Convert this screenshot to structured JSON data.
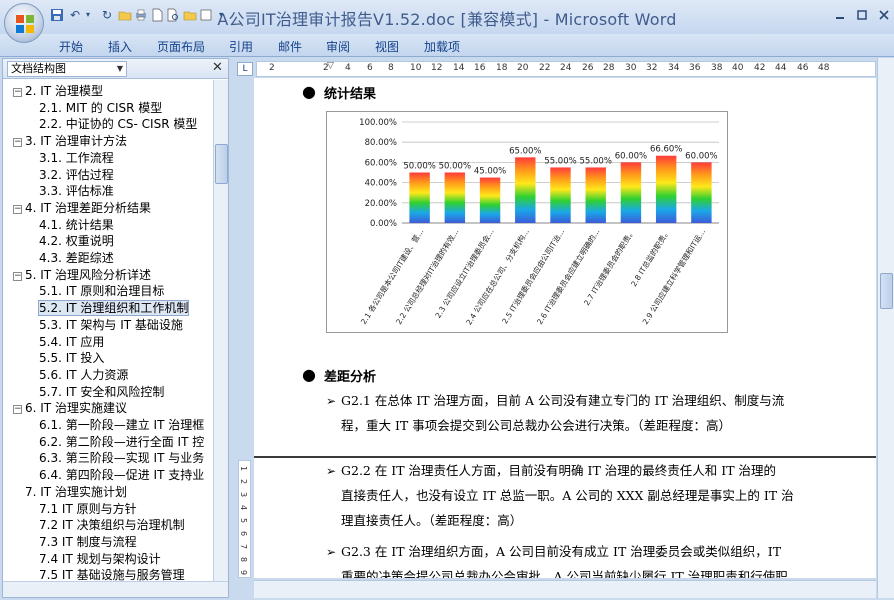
{
  "window": {
    "title": "A公司IT治理审计报告V1.52.doc [兼容模式] - Microsoft Word"
  },
  "ribbon": {
    "tabs": [
      "开始",
      "插入",
      "页面布局",
      "引用",
      "邮件",
      "审阅",
      "视图",
      "加载项"
    ]
  },
  "docmap": {
    "header": "文档结构图",
    "items": [
      {
        "label": "2. IT 治理模型",
        "level": 1,
        "toggle": "−"
      },
      {
        "label": "2.1. MIT 的 CISR 模型",
        "level": 2
      },
      {
        "label": "2.2. 中证协的 CS- CISR 模型",
        "level": 2
      },
      {
        "label": "3. IT 治理审计方法",
        "level": 1,
        "toggle": "−"
      },
      {
        "label": "3.1. 工作流程",
        "level": 2
      },
      {
        "label": "3.2. 评估过程",
        "level": 2
      },
      {
        "label": "3.3. 评估标准",
        "level": 2
      },
      {
        "label": "4. IT 治理差距分析结果",
        "level": 1,
        "toggle": "−"
      },
      {
        "label": "4.1. 统计结果",
        "level": 2
      },
      {
        "label": "4.2. 权重说明",
        "level": 2
      },
      {
        "label": "4.3. 差距综述",
        "level": 2
      },
      {
        "label": "5. IT 治理风险分析详述",
        "level": 1,
        "toggle": "−"
      },
      {
        "label": "5.1. IT 原则和治理目标",
        "level": 2
      },
      {
        "label": "5.2. IT 治理组织和工作机制",
        "level": 2,
        "selected": true
      },
      {
        "label": "5.3. IT 架构与 IT 基础设施",
        "level": 2
      },
      {
        "label": "5.4. IT 应用",
        "level": 2
      },
      {
        "label": "5.5. IT 投入",
        "level": 2
      },
      {
        "label": "5.6. IT 人力资源",
        "level": 2
      },
      {
        "label": "5.7. IT 安全和风险控制",
        "level": 2
      },
      {
        "label": "6. IT 治理实施建议",
        "level": 1,
        "toggle": "−"
      },
      {
        "label": "6.1. 第一阶段—建立 IT 治理框",
        "level": 2
      },
      {
        "label": "6.2. 第二阶段—进行全面 IT 控",
        "level": 2
      },
      {
        "label": "6.3. 第三阶段—实现 IT 与业务",
        "level": 2
      },
      {
        "label": "6.4. 第四阶段—促进 IT 支持业",
        "level": 2
      },
      {
        "label": "7. IT 治理实施计划",
        "level": 1
      },
      {
        "label": "7.1 IT 原则与方针",
        "level": 2
      },
      {
        "label": "7.2 IT 决策组织与治理机制",
        "level": 2
      },
      {
        "label": "7.3 IT 制度与流程",
        "level": 2
      },
      {
        "label": "7.4 IT 规划与架构设计",
        "level": 2
      },
      {
        "label": "7.5 IT 基础设施与服务管理",
        "level": 2
      }
    ]
  },
  "ruler": {
    "ticks": [
      "2",
      "2",
      "4",
      "6",
      "8",
      "10",
      "12",
      "14",
      "16",
      "18",
      "20",
      "22",
      "24",
      "26",
      "28",
      "30",
      "32",
      "34",
      "36",
      "38",
      "40",
      "42",
      "44",
      "46",
      "48"
    ],
    "vticks": [
      "1",
      "2",
      "3",
      "4",
      "5",
      "6",
      "7",
      "8",
      "9"
    ]
  },
  "doc": {
    "heading1": "统计结果",
    "heading2": "差距分析",
    "paragraphs": [
      {
        "lines": [
          "G2.1  在总体 IT 治理方面，目前 A 公司没有建立专门的 IT 治理组织、制度与流",
          "程，重大 IT 事项会提交到公司总裁办公会进行决策。（差距程度：高）"
        ]
      },
      {
        "lines": [
          "G2.2  在 IT 治理责任人方面，目前没有明确 IT 治理的最终责任人和 IT 治理的",
          "直接责任人，也没有设立 IT 总监一职。A 公司的 XXX 副总经理是事实上的 IT 治",
          "理直接责任人。（差距程度：高）"
        ]
      },
      {
        "lines": [
          "G2.3  在 IT 治理组织方面，A 公司目前没有成立 IT 治理委员会或类似组织，IT",
          "重要的决策会提公司总裁办公会审批。A 公司当前缺少履行 IT 治理职责和行使职"
        ]
      }
    ]
  },
  "chart_data": {
    "type": "bar",
    "categories": [
      "2.1 各公司是本公司IT建设、营...",
      "2.2 公司总经理对IT治理的有效...",
      "2.3 公司应设立IT治理委员会...",
      "2.4 公司应在总公司、分支机构...",
      "2.5 IT治理委员会应由公司IT治...",
      "2.6 IT治理委员会应建立明确的...",
      "2.7 IT治理委员会的职责。",
      "2.8 IT总监的职责。",
      "2.9 公司应建立科学管理和IT运..."
    ],
    "values": [
      50.0,
      50.0,
      45.0,
      65.0,
      55.0,
      55.0,
      60.0,
      66.6,
      60.0
    ],
    "data_labels": [
      "50.00%",
      "50.00%",
      "45.00%",
      "65.00%",
      "55.00%",
      "55.00%",
      "60.00%",
      "66.60%",
      "60.00%"
    ],
    "y_ticks": [
      "0.00%",
      "20.00%",
      "40.00%",
      "60.00%",
      "80.00%",
      "100.00%"
    ],
    "ylim": [
      0,
      100
    ],
    "grid": true,
    "legend": "none",
    "bar_gradient": [
      "#ff3b3b",
      "#ff9a1a",
      "#ffe81a",
      "#30d030",
      "#1aa8e8",
      "#3b5bd8"
    ]
  }
}
